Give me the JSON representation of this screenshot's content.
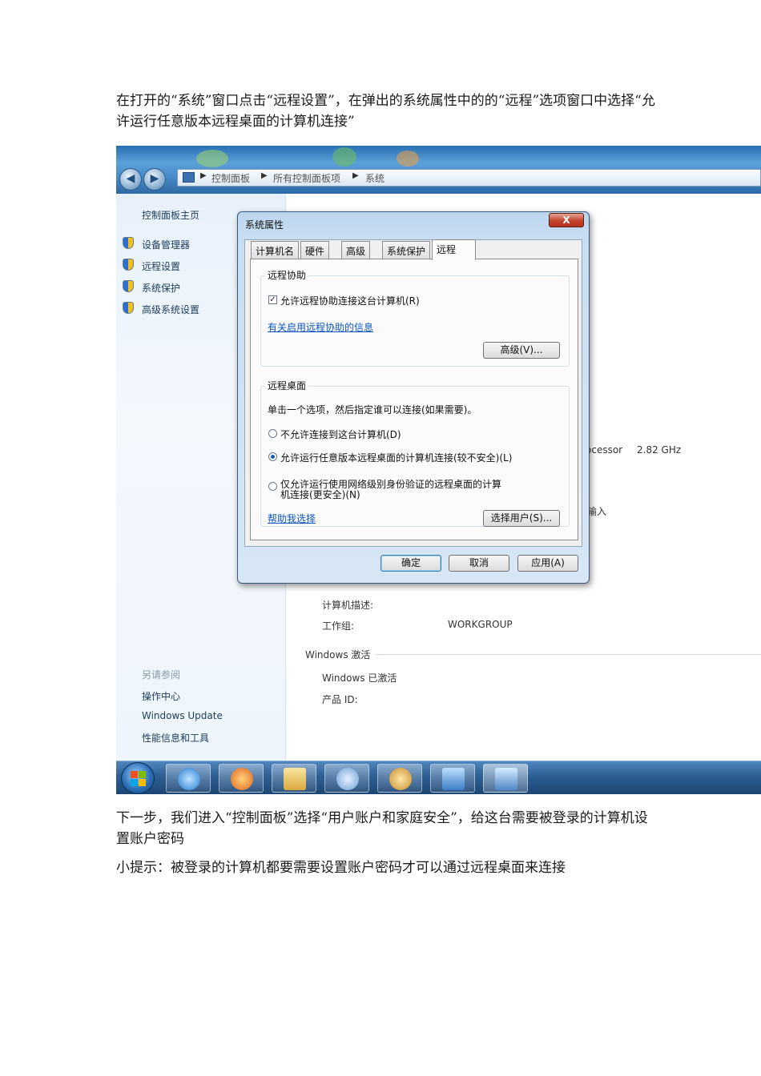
{
  "doc": {
    "para1": "在打开的“系统”窗口点击“远程设置”，在弹出的系统属性中的的“远程”选项窗口中选择“允许运行任意版本远程桌面的计算机连接”",
    "para2": "下一步，我们进入“控制面板”选择“用户账户和家庭安全”，给这台需要被登录的计算机设置账户密码",
    "para3": "小提示：被登录的计算机都要需要设置账户密码才可以通过远程桌面来连接"
  },
  "screenshot": {
    "address": [
      "控制面板",
      "所有控制面板项",
      "系统"
    ],
    "sidebar": {
      "home": "控制面板主页",
      "links": [
        "设备管理器",
        "远程设置",
        "系统保护",
        "高级系统设置"
      ],
      "see_also_title": "另请参阅",
      "see_also": [
        "操作中心",
        "Windows Update",
        "性能信息和工具"
      ]
    },
    "content": {
      "processor_partial": "ocessor",
      "processor_speed": "2.82 GHz",
      "input_partial": "输入",
      "computer_desc_label": "计算机描述:",
      "workgroup_label": "工作组:",
      "workgroup_value": "WORKGROUP",
      "activation_section": "Windows 激活",
      "activation_status": "Windows 已激活",
      "product_id_label": "产品 ID:"
    },
    "dialog": {
      "title": "系统属性",
      "close": "X",
      "tabs": [
        "计算机名",
        "硬件",
        "高级",
        "系统保护",
        "远程"
      ],
      "assist": {
        "group": "远程协助",
        "checkbox": "允许远程协助连接这台计算机(R)",
        "checked": true,
        "link": "有关启用远程协助的信息",
        "advanced_button": "高级(V)..."
      },
      "desktop": {
        "group": "远程桌面",
        "instruction": "单击一个选项，然后指定谁可以连接(如果需要)。",
        "options": [
          "不允许连接到这台计算机(D)",
          "允许运行任意版本远程桌面的计算机连接(较不安全)(L)",
          "仅允许运行使用网络级别身份验证的远程桌面的计算",
          "机连接(更安全)(N)"
        ],
        "selected": 1,
        "help_link": "帮助我选择",
        "select_users_button": "选择用户(S)..."
      },
      "buttons": {
        "ok": "确定",
        "cancel": "取消",
        "apply": "应用(A)"
      }
    }
  }
}
